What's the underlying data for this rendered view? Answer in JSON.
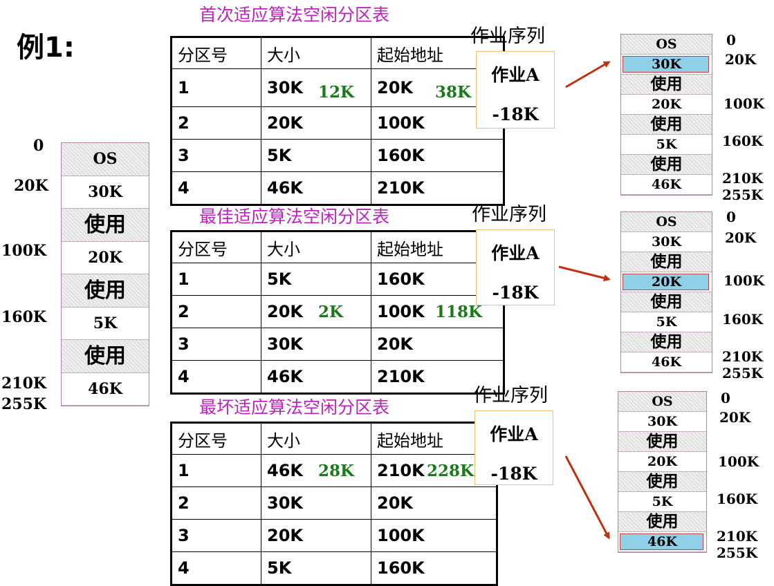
{
  "example_label": "例1:",
  "left_memory": {
    "blocks": [
      {
        "label": "OS",
        "kind": "used"
      },
      {
        "label": "30K",
        "kind": "free"
      },
      {
        "label": "使用",
        "kind": "used"
      },
      {
        "label": "20K",
        "kind": "free"
      },
      {
        "label": "使用",
        "kind": "used"
      },
      {
        "label": "5K",
        "kind": "free"
      },
      {
        "label": "使用",
        "kind": "used"
      },
      {
        "label": "46K",
        "kind": "free"
      }
    ],
    "addresses": [
      "0",
      "20K",
      "100K",
      "160K",
      "210K",
      "255K"
    ]
  },
  "tables": [
    {
      "title": "首次适应算法空闲分区表",
      "headers": [
        "分区号",
        "大小",
        "起始地址"
      ],
      "rows": [
        {
          "id": "1",
          "size": "30K",
          "start": "20K",
          "size_note": "12K",
          "start_note": "38K"
        },
        {
          "id": "2",
          "size": "20K",
          "start": "100K",
          "size_note": "",
          "start_note": ""
        },
        {
          "id": "3",
          "size": "5K",
          "start": "160K",
          "size_note": "",
          "start_note": ""
        },
        {
          "id": "4",
          "size": "46K",
          "start": "210K",
          "size_note": "",
          "start_note": ""
        }
      ]
    },
    {
      "title": "最佳适应算法空闲分区表",
      "headers": [
        "分区号",
        "大小",
        "起始地址"
      ],
      "rows": [
        {
          "id": "1",
          "size": "5K",
          "start": "160K",
          "size_note": "",
          "start_note": ""
        },
        {
          "id": "2",
          "size": "20K",
          "start": "100K",
          "size_note": "2K",
          "start_note": "118K"
        },
        {
          "id": "3",
          "size": "30K",
          "start": "20K",
          "size_note": "",
          "start_note": ""
        },
        {
          "id": "4",
          "size": "46K",
          "start": "210K",
          "size_note": "",
          "start_note": ""
        }
      ]
    },
    {
      "title": "最坏适应算法空闲分区表",
      "headers": [
        "分区号",
        "大小",
        "起始地址"
      ],
      "rows": [
        {
          "id": "1",
          "size": "46K",
          "start": "210K",
          "size_note": "28K",
          "start_note": "228K"
        },
        {
          "id": "2",
          "size": "30K",
          "start": "20K",
          "size_note": "",
          "start_note": ""
        },
        {
          "id": "3",
          "size": "20K",
          "start": "100K",
          "size_note": "",
          "start_note": ""
        },
        {
          "id": "4",
          "size": "5K",
          "start": "160K",
          "size_note": "",
          "start_note": ""
        }
      ]
    }
  ],
  "job_queues": [
    {
      "title": "作业序列",
      "job": "作业A",
      "size": "-18K"
    },
    {
      "title": "作业序列",
      "job": "作业A",
      "size": "-18K"
    },
    {
      "title": "作业序列",
      "job": "作业A",
      "size": "-18K"
    }
  ],
  "result_memories": [
    {
      "blocks": [
        {
          "label": "OS",
          "kind": "used"
        },
        {
          "label": "30K",
          "kind": "hl"
        },
        {
          "label": "使用",
          "kind": "used"
        },
        {
          "label": "20K",
          "kind": "free"
        },
        {
          "label": "使用",
          "kind": "used"
        },
        {
          "label": "5K",
          "kind": "free"
        },
        {
          "label": "使用",
          "kind": "used"
        },
        {
          "label": "46K",
          "kind": "free"
        }
      ],
      "addresses": [
        "0",
        "20K",
        "100K",
        "160K",
        "210K",
        "255K"
      ]
    },
    {
      "blocks": [
        {
          "label": "OS",
          "kind": "used"
        },
        {
          "label": "30K",
          "kind": "free"
        },
        {
          "label": "使用",
          "kind": "used"
        },
        {
          "label": "20K",
          "kind": "hl"
        },
        {
          "label": "使用",
          "kind": "used"
        },
        {
          "label": "5K",
          "kind": "free"
        },
        {
          "label": "使用",
          "kind": "used"
        },
        {
          "label": "46K",
          "kind": "free"
        }
      ],
      "addresses": [
        "0",
        "20K",
        "100K",
        "160K",
        "210K",
        "255K"
      ]
    },
    {
      "blocks": [
        {
          "label": "OS",
          "kind": "used"
        },
        {
          "label": "30K",
          "kind": "free"
        },
        {
          "label": "使用",
          "kind": "used"
        },
        {
          "label": "20K",
          "kind": "free"
        },
        {
          "label": "使用",
          "kind": "used"
        },
        {
          "label": "5K",
          "kind": "free"
        },
        {
          "label": "使用",
          "kind": "used"
        },
        {
          "label": "46K",
          "kind": "hl"
        }
      ],
      "addresses": [
        "0",
        "20K",
        "100K",
        "160K",
        "210K",
        "255K"
      ]
    }
  ],
  "colors": {
    "table_title": "#c020c0",
    "note_green": "#1a7a1a",
    "arrow": "#c03010",
    "highlight": "#8fd0e8",
    "job_box_border": "#f0c070"
  }
}
